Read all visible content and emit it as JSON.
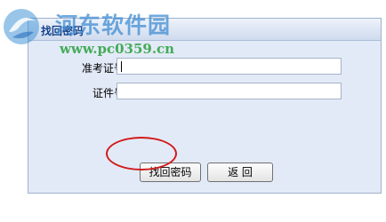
{
  "panel": {
    "title": "找回密码"
  },
  "form": {
    "fields": [
      {
        "label": "准考证号",
        "required_mark": "*",
        "suffix": "：",
        "value": ""
      },
      {
        "label": "证件号",
        "required_mark": "*",
        "suffix": "：",
        "value": ""
      }
    ]
  },
  "buttons": {
    "retrieve": "找回密码",
    "back": "返 回"
  },
  "watermark": {
    "title": "河东软件园",
    "url": "www.pc0359.cn"
  },
  "colors": {
    "required": "#ff0000",
    "highlight_circle": "#d11a1a",
    "panel_bg": "#e3eaf7"
  }
}
